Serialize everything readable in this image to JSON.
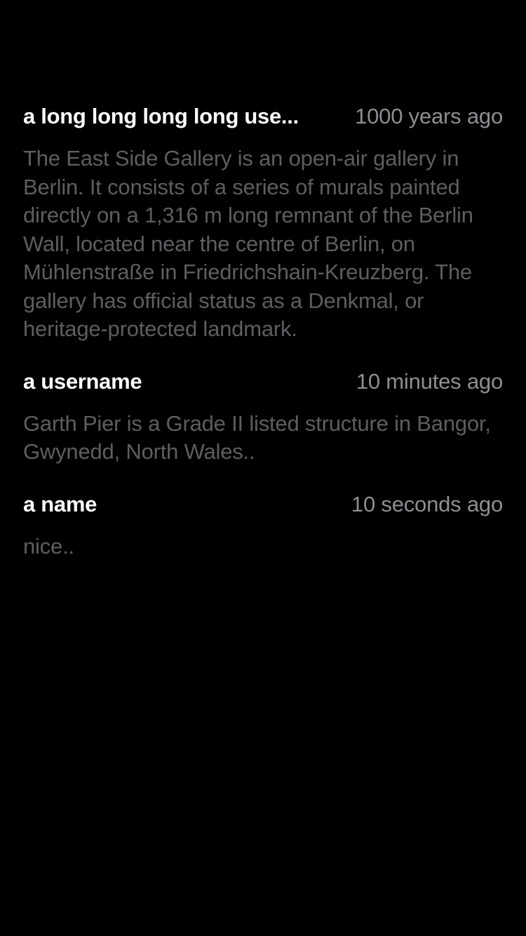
{
  "comments": [
    {
      "username": "a long long long long use...",
      "time": "1000 years ago",
      "body": "The East Side Gallery is an open-air gallery in Berlin. It consists of a series of murals painted directly on a 1,316 m long remnant of the Berlin Wall, located near the centre of Berlin, on Mühlenstraße in Friedrichshain-Kreuzberg. The gallery has official status as a Denkmal, or heritage-protected landmark."
    },
    {
      "username": "a username",
      "time": "10 minutes ago",
      "body": "Garth Pier is a Grade II listed structure in Bangor, Gwynedd, North Wales.."
    },
    {
      "username": "a name",
      "time": "10 seconds ago",
      "body": "nice.."
    }
  ],
  "colors": {
    "background": "#000000",
    "username": "#ffffff",
    "time": "#8e8e93",
    "body": "#5e5e62"
  }
}
